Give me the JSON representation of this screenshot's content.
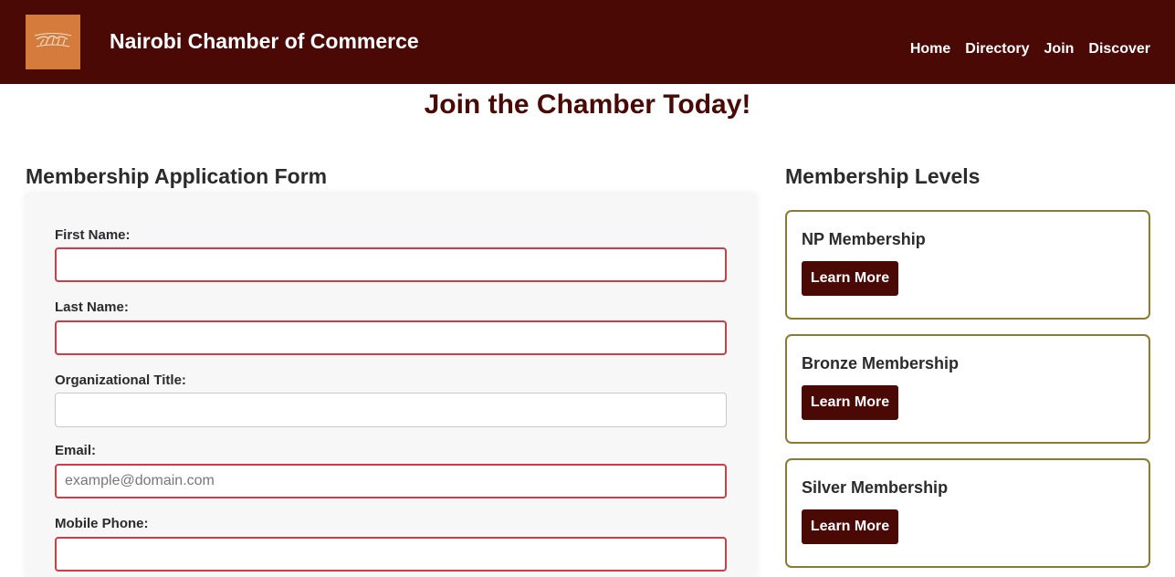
{
  "header": {
    "site_title": "Nairobi Chamber of Commerce",
    "logo_icon": "chamber-logo",
    "background_color": "#4a0905",
    "logo_color": "#d57b3c",
    "nav": [
      {
        "label": "Home"
      },
      {
        "label": "Directory"
      },
      {
        "label": "Join"
      },
      {
        "label": "Discover"
      }
    ]
  },
  "main": {
    "page_heading": "Join the Chamber Today!"
  },
  "form": {
    "heading": "Membership Application Form",
    "fields": [
      {
        "label": "First Name:",
        "value": "",
        "placeholder": "",
        "required": true
      },
      {
        "label": "Last Name:",
        "value": "",
        "placeholder": "",
        "required": true
      },
      {
        "label": "Organizational Title:",
        "value": "",
        "placeholder": "",
        "required": false
      },
      {
        "label": "Email:",
        "value": "",
        "placeholder": "example@domain.com",
        "required": true
      },
      {
        "label": "Mobile Phone:",
        "value": "",
        "placeholder": "",
        "required": true
      }
    ],
    "required_border_color": "#cf3b47"
  },
  "levels": {
    "heading": "Membership Levels",
    "card_border_color": "#8c7a2e",
    "items": [
      {
        "name": "NP Membership",
        "button_label": "Learn More"
      },
      {
        "name": "Bronze Membership",
        "button_label": "Learn More"
      },
      {
        "name": "Silver Membership",
        "button_label": "Learn More"
      }
    ]
  }
}
